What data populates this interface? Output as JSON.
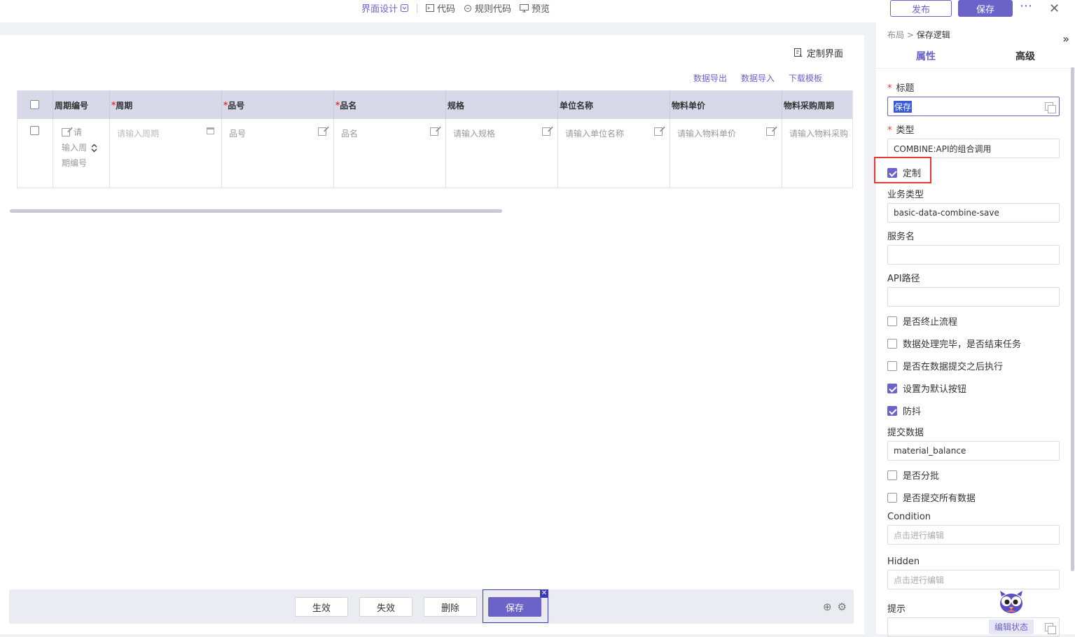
{
  "topnav": {
    "design": "界面设计",
    "code": "代码",
    "rule_code": "规则代码",
    "preview": "预览",
    "publish": "发布",
    "save": "保存"
  },
  "canvas": {
    "custom_ui": "定制界面",
    "links": [
      "数据导出",
      "数据导入",
      "下载模板"
    ],
    "columns": [
      {
        "label": "周期编号",
        "required": false
      },
      {
        "label": "周期",
        "required": true
      },
      {
        "label": "品号",
        "required": true
      },
      {
        "label": "品名",
        "required": true
      },
      {
        "label": "规格",
        "required": false
      },
      {
        "label": "单位名称",
        "required": false
      },
      {
        "label": "物料单价",
        "required": false
      },
      {
        "label": "物料采购周期",
        "required": false
      }
    ],
    "row": {
      "c0_l1": "请",
      "c0_l2": "输入周",
      "c0_l3": "期编号",
      "c1": "请输入周期",
      "c2": "品号",
      "c3": "品名",
      "c4": "请输入规格",
      "c5": "请输入单位名称",
      "c6": "请输入物料单价",
      "c7": "请输入物料采购"
    }
  },
  "bottombar": {
    "effective": "生效",
    "invalid": "失效",
    "delete": "删除",
    "save": "保存"
  },
  "panel": {
    "crumb_root": "布局",
    "crumb_sep": ">",
    "crumb_current": "保存逻辑",
    "tab_props": "属性",
    "tab_advanced": "高级",
    "title_label": "标题",
    "title_value": "保存",
    "type_label": "类型",
    "type_value": "COMBINE:API的组合调用",
    "custom_label": "定制",
    "biz_type_label": "业务类型",
    "biz_type_value": "basic-data-combine-save",
    "service_label": "服务名",
    "api_label": "API路径",
    "cb_stop_flow": "是否终止流程",
    "cb_end_task": "数据处理完毕，是否结束任务",
    "cb_after_submit": "是否在数据提交之后执行",
    "cb_default_btn": "设置为默认按钮",
    "cb_debounce": "防抖",
    "submit_data_label": "提交数据",
    "submit_data_value": "material_balance",
    "cb_batch": "是否分批",
    "cb_submit_all": "是否提交所有数据",
    "condition_label": "Condition",
    "condition_ph": "点击进行编辑",
    "hidden_label": "Hidden",
    "hidden_ph": "点击进行编辑",
    "tip_label": "提示",
    "edit_state": "编辑状态"
  },
  "colors": {
    "accent": "#6c63c9",
    "highlight": "#e53935"
  }
}
